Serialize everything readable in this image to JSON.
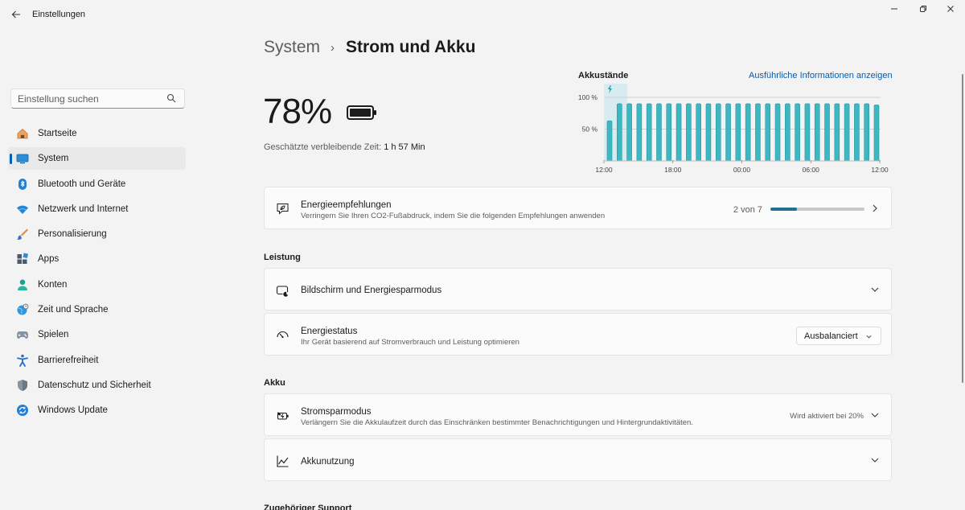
{
  "window": {
    "title": "Einstellungen",
    "controls": [
      "minimize-icon",
      "restore-icon",
      "close-icon"
    ]
  },
  "sidebar": {
    "search_placeholder": "Einstellung suchen",
    "items": [
      {
        "label": "Startseite",
        "icon": "home-icon",
        "active": false
      },
      {
        "label": "System",
        "icon": "system-icon",
        "active": true
      },
      {
        "label": "Bluetooth und Geräte",
        "icon": "bluetooth-icon",
        "active": false
      },
      {
        "label": "Netzwerk und Internet",
        "icon": "wifi-icon",
        "active": false
      },
      {
        "label": "Personalisierung",
        "icon": "brush-icon",
        "active": false
      },
      {
        "label": "Apps",
        "icon": "apps-icon",
        "active": false
      },
      {
        "label": "Konten",
        "icon": "account-icon",
        "active": false
      },
      {
        "label": "Zeit und Sprache",
        "icon": "globe-icon",
        "active": false
      },
      {
        "label": "Spielen",
        "icon": "gamepad-icon",
        "active": false
      },
      {
        "label": "Barrierefreiheit",
        "icon": "accessibility-icon",
        "active": false
      },
      {
        "label": "Datenschutz und Sicherheit",
        "icon": "shield-icon",
        "active": false
      },
      {
        "label": "Windows Update",
        "icon": "update-icon",
        "active": false
      }
    ]
  },
  "header": {
    "parent": "System",
    "current": "Strom und Akku"
  },
  "battery": {
    "percent": "78%",
    "remaining_label": "Geschätzte verbleibende Zeit:",
    "remaining_value": "1 h 57 Min"
  },
  "chart_data": {
    "type": "bar",
    "title": "Akkustände",
    "link": "Ausführliche Informationen anzeigen",
    "y_ticks": [
      "100 %",
      "50 %"
    ],
    "x_ticks": [
      "12:00",
      "18:00",
      "00:00",
      "06:00",
      "12:00"
    ],
    "ylim": [
      0,
      100
    ],
    "values": [
      63,
      90,
      90,
      90,
      90,
      90,
      90,
      90,
      90,
      90,
      90,
      90,
      90,
      90,
      90,
      90,
      90,
      90,
      90,
      90,
      90,
      90,
      90,
      90,
      90,
      90,
      90,
      88
    ],
    "charging_marker": "lightning-icon",
    "bar_color": "#3db8c2",
    "highlight_color": "#d6ecf0"
  },
  "recommendations": {
    "title": "Energieempfehlungen",
    "subtitle": "Verringern Sie Ihren CO2-Fußabdruck, indem Sie die folgenden Empfehlungen anwenden",
    "count": "2 von 7",
    "progress": 0.285
  },
  "sections": {
    "performance": "Leistung",
    "battery": "Akku",
    "support": "Zugehöriger Support"
  },
  "screen_power": {
    "title": "Bildschirm und Energiesparmodus"
  },
  "power_mode": {
    "title": "Energiestatus",
    "subtitle": "Ihr Gerät basierend auf Stromverbrauch und Leistung optimieren",
    "selected": "Ausbalanciert"
  },
  "battery_saver": {
    "title": "Stromsparmodus",
    "subtitle": "Verlängern Sie die Akkulaufzeit durch das Einschränken bestimmter Benachrichtigungen und Hintergrundaktivitäten.",
    "status": "Wird aktiviert bei 20%"
  },
  "battery_usage": {
    "title": "Akkunutzung"
  },
  "colors": {
    "accent": "#005fb8",
    "link": "#0a5ba8",
    "progress": "#1f6f93"
  }
}
